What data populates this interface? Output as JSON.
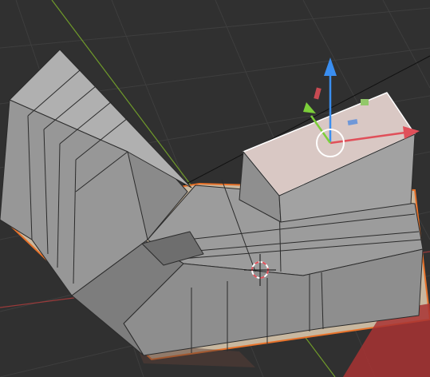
{
  "app": {
    "name": "3D Viewport"
  },
  "viewport": {
    "background": "#303030",
    "grid_color": "#3d3d3d",
    "x_axis_color": "#9a3a3a",
    "y_axis_color": "#6f9a2a",
    "object_selection_color": "#e8722a",
    "selected_face_color": "#d9c8c4",
    "mesh_face_color": "#9a9a9a",
    "mesh_edge_color": "#2b2b2b"
  },
  "gizmo": {
    "axes": [
      {
        "name": "x",
        "color": "#e0505a",
        "icon": "arrow-right-icon"
      },
      {
        "name": "y",
        "color": "#7ccf3a",
        "icon": "arrow-up-left-icon"
      },
      {
        "name": "z",
        "color": "#3a8ef0",
        "icon": "arrow-up-icon"
      }
    ],
    "center_ring_color": "#ffffff"
  },
  "cursor": {
    "icon": "3d-cursor-icon",
    "colors": [
      "#ffffff",
      "#e0505a"
    ]
  }
}
